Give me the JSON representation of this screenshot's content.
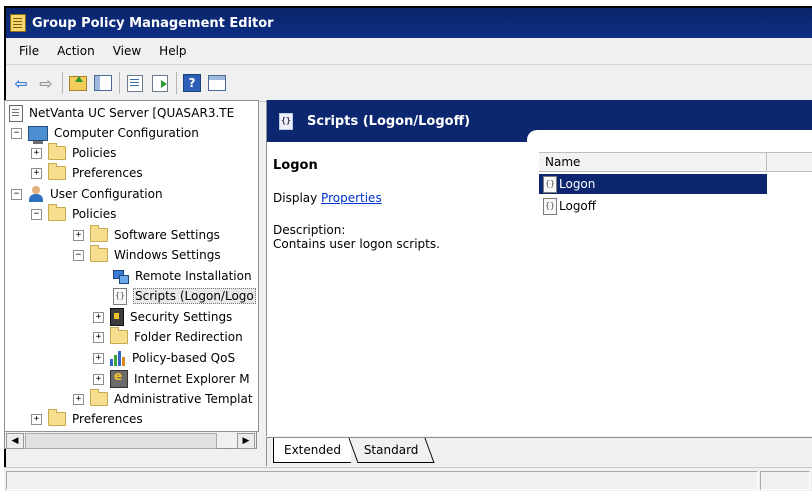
{
  "window": {
    "title": "Group Policy Management Editor"
  },
  "menu": [
    "File",
    "Action",
    "View",
    "Help"
  ],
  "toolbar": {
    "icons": [
      "back-arrow-icon",
      "forward-arrow-icon",
      "up-folder-icon",
      "show-tree-icon",
      "properties-icon",
      "export-list-icon",
      "help-icon",
      "view-icon"
    ],
    "help_glyph": "?"
  },
  "tree": {
    "root": "NetVanta UC Server [QUASAR3.TE",
    "computer_config": "Computer Configuration",
    "cc_policies": "Policies",
    "cc_preferences": "Preferences",
    "user_config": "User Configuration",
    "uc_policies": "Policies",
    "software_settings": "Software Settings",
    "windows_settings": "Windows Settings",
    "remote_installation": "Remote Installation",
    "scripts": "Scripts (Logon/Logo",
    "security_settings": "Security Settings",
    "folder_redirection": "Folder Redirection",
    "policy_qos": "Policy-based QoS",
    "internet_explorer": "Internet Explorer M",
    "admin_templates": "Administrative Templat",
    "uc_preferences": "Preferences",
    "expand_plus": "+",
    "expand_minus": "−"
  },
  "right": {
    "header_title": "Scripts (Logon/Logoff)",
    "section_title": "Logon",
    "display_prefix": "Display ",
    "properties_link": "Properties",
    "description_label": "Description:",
    "description_text": "Contains user logon scripts.",
    "column_name": "Name",
    "items": [
      "Logon",
      "Logoff"
    ]
  },
  "tabs": [
    "Extended",
    "Standard"
  ],
  "colors": {
    "header_bg": "#0c2770",
    "title_bg": "#0a246a",
    "link": "#0033cc"
  }
}
